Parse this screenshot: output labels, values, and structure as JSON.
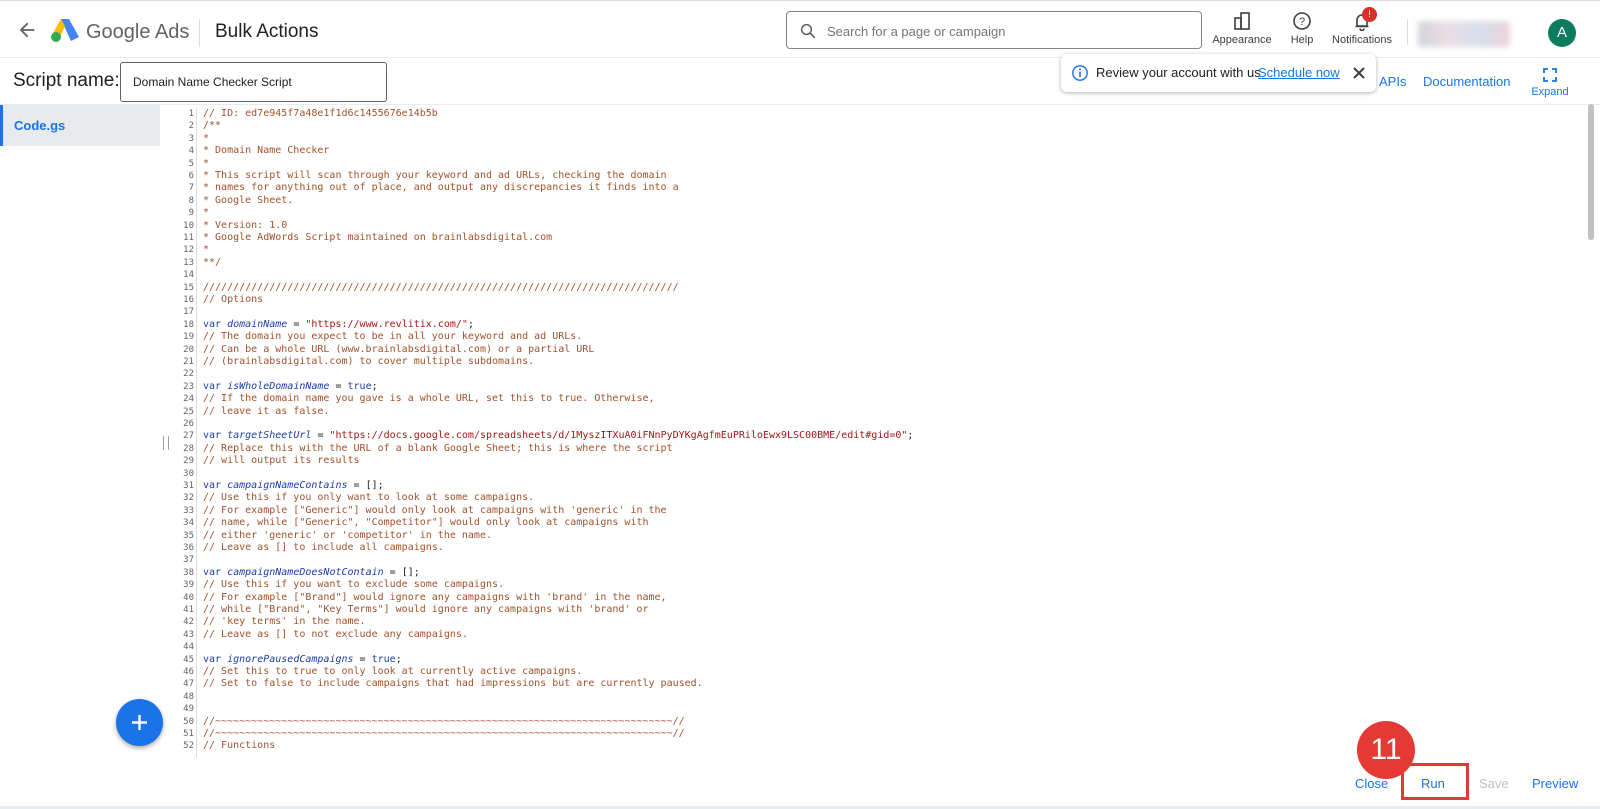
{
  "header": {
    "brand": "Google Ads",
    "page_title": "Bulk Actions",
    "search_placeholder": "Search for a page or campaign",
    "appearance_label": "Appearance",
    "help_label": "Help",
    "notifications_label": "Notifications",
    "notifications_badge": "!",
    "avatar_letter": "A"
  },
  "script": {
    "label": "Script name:",
    "name_value": "Domain Name Checker Script"
  },
  "toast": {
    "text": "Review your account with us",
    "link": "Schedule now"
  },
  "links": {
    "apis": "APIs",
    "documentation": "Documentation",
    "expand": "Expand"
  },
  "file_tab": "Code.gs",
  "code_lines": [
    "// ID: ed7e945f7a48e1f1d6c1455676e14b5b",
    "/**",
    "*",
    "* Domain Name Checker",
    "*",
    "* This script will scan through your keyword and ad URLs, checking the domain",
    "* names for anything out of place, and output any discrepancies it finds into a",
    "* Google Sheet.",
    "*",
    "* Version: 1.0",
    "* Google AdWords Script maintained on brainlabsdigital.com",
    "*",
    "**/",
    "",
    "///////////////////////////////////////////////////////////////////////////////",
    "// Options",
    "",
    "var domainName = \"https://www.revlitix.com/\";",
    "// The domain you expect to be in all your keyword and ad URLs.",
    "// Can be a whole URL (www.brainlabsdigital.com) or a partial URL",
    "// (brainlabsdigital.com) to cover multiple subdomains.",
    "",
    "var isWholeDomainName = true;",
    "// If the domain name you gave is a whole URL, set this to true. Otherwise,",
    "// leave it as false.",
    "",
    "var targetSheetUrl = \"https://docs.google.com/spreadsheets/d/1MyszITXuA0iFNnPyDYKgAgfmEuPRiloEwx9LSC00BME/edit#gid=0\";",
    "// Replace this with the URL of a blank Google Sheet; this is where the script",
    "// will output its results",
    "",
    "var campaignNameContains = [];",
    "// Use this if you only want to look at some campaigns.",
    "// For example [\"Generic\"] would only look at campaigns with 'generic' in the",
    "// name, while [\"Generic\", \"Competitor\"] would only look at campaigns with",
    "// either 'generic' or 'competitor' in the name.",
    "// Leave as [] to include all campaigns.",
    "",
    "var campaignNameDoesNotContain = [];",
    "// Use this if you want to exclude some campaigns.",
    "// For example [\"Brand\"] would ignore any campaigns with 'brand' in the name,",
    "// while [\"Brand\", \"Key Terms\"] would ignore any campaigns with 'brand' or",
    "// 'key terms' in the name.",
    "// Leave as [] to not exclude any campaigns.",
    "",
    "var ignorePausedCampaigns = true;",
    "// Set this to true to only look at currently active campaigns.",
    "// Set to false to include campaigns that had impressions but are currently paused.",
    "",
    "",
    "//~~~~~~~~~~~~~~~~~~~~~~~~~~~~~~~~~~~~~~~~~~~~~~~~~~~~~~~~~~~~~~~~~~~~~~~~~~~~//",
    "//~~~~~~~~~~~~~~~~~~~~~~~~~~~~~~~~~~~~~~~~~~~~~~~~~~~~~~~~~~~~~~~~~~~~~~~~~~~~//",
    "// Functions"
  ],
  "footer": {
    "close": "Close",
    "run": "Run",
    "save": "Save",
    "preview": "Preview",
    "step_number": "11"
  },
  "colors": {
    "accent": "#1a73e8",
    "highlight": "#e53935",
    "comment": "#a0522d",
    "keyword": "#1a3da8"
  }
}
